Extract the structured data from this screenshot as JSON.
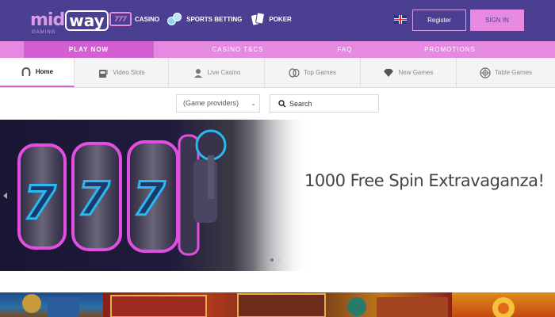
{
  "brand": {
    "logo_main_left": "mid",
    "logo_main_right": "way",
    "logo_sub": "GAMING"
  },
  "topnav": {
    "items": [
      {
        "label": "CASINO",
        "icon": "slot-777-icon"
      },
      {
        "label": "SPORTS BETTING",
        "icon": "sports-balls-icon"
      },
      {
        "label": "POKER",
        "icon": "playing-cards-icon"
      }
    ],
    "icon_777_text": "777"
  },
  "auth": {
    "register_label": "Register",
    "signin_label": "SIGN IN",
    "language_icon": "uk-flag-icon"
  },
  "subnav": {
    "items": [
      {
        "label": "PLAY NOW"
      },
      {
        "label": "CASINO T&CS"
      },
      {
        "label": "FAQ"
      },
      {
        "label": "PROMOTIONS"
      }
    ]
  },
  "categories": {
    "tabs": [
      {
        "label": "Home",
        "icon": "horseshoe-icon"
      },
      {
        "label": "Video Slots",
        "icon": "slot-machine-icon"
      },
      {
        "label": "Live Casino",
        "icon": "dealer-icon"
      },
      {
        "label": "Top Games",
        "icon": "masks-icon"
      },
      {
        "label": "New Games",
        "icon": "diamond-icon"
      },
      {
        "label": "Table Games",
        "icon": "roulette-icon"
      }
    ]
  },
  "filters": {
    "providers_value": "(Game providers)",
    "search_placeholder": "Search"
  },
  "banner": {
    "title": "1000 Free Spin Extravaganza!",
    "slide_count": 2,
    "active_slide": 2
  },
  "colors": {
    "header": "#4b3f91",
    "accent_pink": "#e58ae0",
    "accent_pink_dark": "#d35fd3",
    "neon_blue": "#2ab8f0",
    "neon_pink": "#e04fe0"
  }
}
